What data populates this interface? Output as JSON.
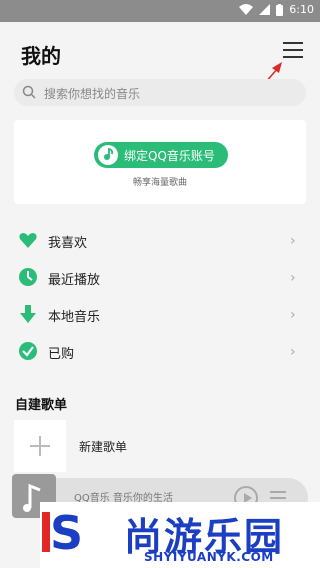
{
  "status_bar": {
    "time": "6:10"
  },
  "header": {
    "title": "我的"
  },
  "search": {
    "placeholder": "搜索你想找的音乐"
  },
  "bind_card": {
    "button_label": "绑定QQ音乐账号",
    "subtitle": "畅享海量歌曲"
  },
  "menu": {
    "items": [
      {
        "label": "我喜欢",
        "icon": "heart-icon"
      },
      {
        "label": "最近播放",
        "icon": "clock-icon"
      },
      {
        "label": "本地音乐",
        "icon": "download-icon"
      },
      {
        "label": "已购",
        "icon": "check-circle-icon"
      }
    ]
  },
  "playlists": {
    "section_title": "自建歌单",
    "new_label": "新建歌单"
  },
  "player": {
    "text": "QQ音乐 音乐你的生活"
  },
  "watermark": {
    "cn": "尚游乐园",
    "en": "SHYIYUANYK.COM"
  },
  "colors": {
    "accent": "#2bbd78",
    "status_bar": "#8c8c8c",
    "annotation": "#d92b2b",
    "watermark": "#1b3ec2"
  }
}
